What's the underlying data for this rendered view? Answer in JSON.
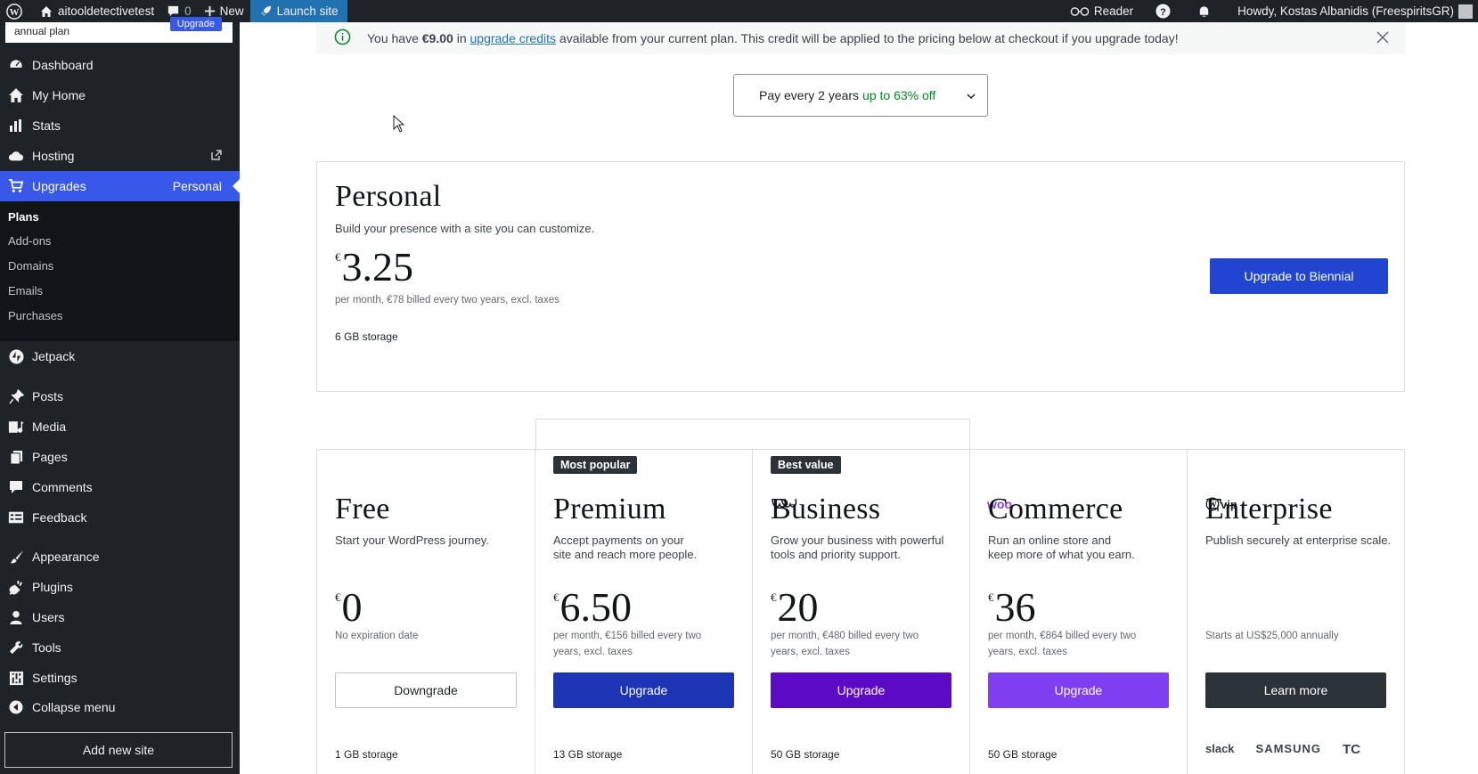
{
  "adminbar": {
    "site_name": "aitooldetectivetest",
    "comments_count": "0",
    "new_label": "New",
    "launch_label": "Launch site",
    "reader_label": "Reader",
    "howdy": "Howdy, Kostas Albanidis (FreespiritsGR)"
  },
  "sidebar": {
    "notice_text": "annual plan",
    "notice_button": "Upgrade",
    "items": [
      {
        "label": "Dashboard"
      },
      {
        "label": "My Home"
      },
      {
        "label": "Stats"
      },
      {
        "label": "Hosting"
      },
      {
        "label": "Upgrades",
        "badge": "Personal"
      },
      {
        "label": "Jetpack"
      },
      {
        "label": "Posts"
      },
      {
        "label": "Media"
      },
      {
        "label": "Pages"
      },
      {
        "label": "Comments"
      },
      {
        "label": "Feedback"
      },
      {
        "label": "Appearance"
      },
      {
        "label": "Plugins"
      },
      {
        "label": "Users"
      },
      {
        "label": "Tools"
      },
      {
        "label": "Settings"
      },
      {
        "label": "Collapse menu"
      }
    ],
    "submenu": [
      "Plans",
      "Add-ons",
      "Domains",
      "Emails",
      "Purchases"
    ],
    "add_site": "Add new site"
  },
  "banner": {
    "prefix": "You have ",
    "amount": "€9.00",
    "mid": " in ",
    "link": "upgrade credits",
    "suffix": " available from your current plan. This credit will be applied to the pricing below at checkout if you upgrade today!"
  },
  "term": {
    "label": "Pay every 2 years",
    "discount": "up to 63% off"
  },
  "current_plan": {
    "title": "Personal",
    "tagline": "Build your presence with a site you can customize.",
    "currency": "€",
    "price": "3.25",
    "billing": "per month, €78 billed every two years, excl. taxes",
    "storage": "6 GB storage",
    "button": "Upgrade to Biennial"
  },
  "plans": [
    {
      "title": "Free",
      "tagline1": "Start your WordPress journey.",
      "tagline2": "",
      "currency": "€",
      "price": "0",
      "billing1": "No expiration date",
      "billing2": "",
      "button": "Downgrade",
      "storage": "1 GB storage"
    },
    {
      "title": "Premium",
      "badge": "Most popular",
      "tagline1": "Accept payments on your",
      "tagline2": "site and reach more people.",
      "currency": "€",
      "price": "6.50",
      "billing1": "per month, €156 billed every two",
      "billing2": "years, excl. taxes",
      "button": "Upgrade",
      "storage": "13 GB storage"
    },
    {
      "title": "Business",
      "badge": "Best value",
      "tagline1": "Grow your business with powerful",
      "tagline2": "tools and priority support.",
      "currency": "€",
      "price": "20",
      "billing1": "per month, €480 billed every two",
      "billing2": "years, excl. taxes",
      "button": "Upgrade",
      "storage": "50 GB storage"
    },
    {
      "title": "Commerce",
      "logo": "woo",
      "tagline1": "Run an online store and",
      "tagline2": "keep more of what you earn.",
      "currency": "€",
      "price": "36",
      "billing1": "per month, €864 billed every two",
      "billing2": "years, excl. taxes",
      "button": "Upgrade",
      "storage": "50 GB storage"
    },
    {
      "title": "Enterprise",
      "logo": "vip",
      "tagline1": "Publish securely at enterprise scale.",
      "tagline2": "",
      "billing1": "Starts at US$25,000 annually",
      "button": "Learn more"
    }
  ],
  "enterprise_clients": [
    "slack",
    "SAMSUNG",
    "TC"
  ],
  "colors": {
    "accent": "#3858e9",
    "premium": "#1d35b4",
    "business": "#5b0bc4",
    "commerce": "#7f3ff0",
    "enterprise": "#2c3338",
    "current_btn": "#2145d0"
  }
}
